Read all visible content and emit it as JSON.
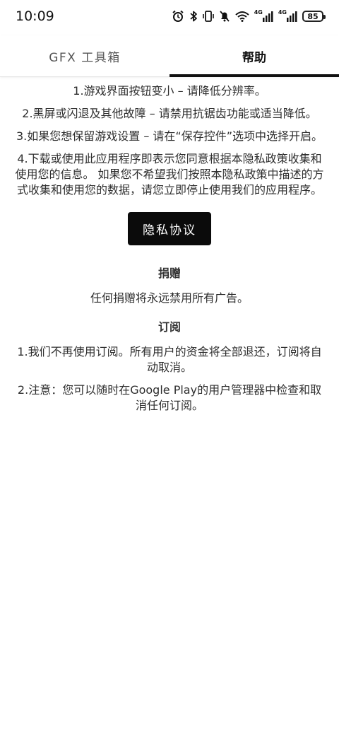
{
  "status_bar": {
    "time": "10:09",
    "signal_label_1": "4G",
    "signal_label_2": "4G",
    "battery": "85"
  },
  "tabs": [
    {
      "label": "GFX 工具箱",
      "active": false
    },
    {
      "label": "帮助",
      "active": true
    }
  ],
  "help": {
    "items": [
      "1.游戏界面按钮变小 – 请降低分辨率。",
      "2.黑屏或闪退及其他故障 – 请禁用抗锯齿功能或适当降低。",
      "3.如果您想保留游戏设置 – 请在“保存控件”选项中选择开启。",
      "4.下载或使用此应用程序即表示您同意根据本隐私政策收集和使用您的信息。 如果您不希望我们按照本隐私政策中描述的方式收集和使用您的数据，请您立即停止使用我们的应用程序。"
    ],
    "privacy_button": "隐私协议"
  },
  "donation": {
    "title": "捐赠",
    "text": "任何捐赠将永远禁用所有广告。"
  },
  "subscription": {
    "title": "订阅",
    "items": [
      "1.我们不再使用订阅。所有用户的资金将全部退还，订阅将自动取消。",
      "2.注意：您可以随时在Google Play的用户管理器中检查和取消任何订阅。"
    ]
  },
  "colors": {
    "accent": "#0b0b0b",
    "text": "#2e2e2e",
    "background": "#ffffff"
  },
  "icons": [
    "alarm-icon",
    "bluetooth-icon",
    "vibrate-icon",
    "mute-icon",
    "wifi-icon",
    "signal-icon",
    "signal-icon",
    "battery-icon"
  ]
}
